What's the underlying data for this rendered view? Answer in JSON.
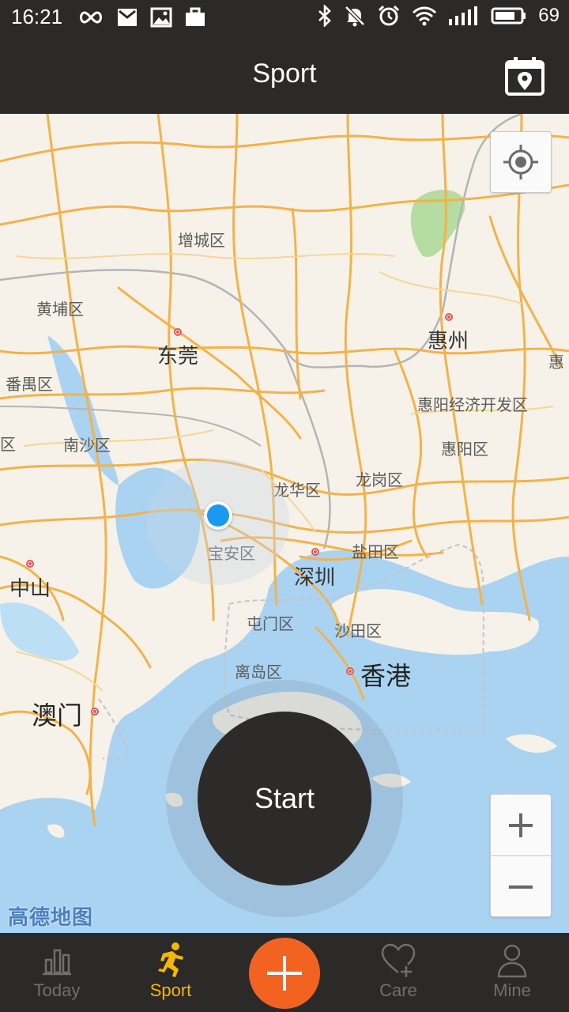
{
  "status_bar": {
    "time": "16:21",
    "battery": "69",
    "icons": [
      "infinity-icon",
      "mail-icon",
      "image-icon",
      "briefcase-icon",
      "bluetooth-icon",
      "mute-icon",
      "alarm-icon",
      "wifi-icon",
      "signal-icon",
      "battery-icon"
    ]
  },
  "header": {
    "title": "Sport",
    "calendar_icon": "calendar-location-icon"
  },
  "map": {
    "provider": "高德地图",
    "labels": [
      {
        "name": "zengcheng",
        "text": "增城区"
      },
      {
        "name": "huangpu",
        "text": "黄埔区"
      },
      {
        "name": "dongguan",
        "text": "东莞"
      },
      {
        "name": "huizhou",
        "text": "惠州"
      },
      {
        "name": "panyu",
        "text": "番禺区"
      },
      {
        "name": "huiyang-dev",
        "text": "惠阳经济开发区"
      },
      {
        "name": "nansha",
        "text": "南沙区"
      },
      {
        "name": "huiyang",
        "text": "惠阳区"
      },
      {
        "name": "longhua",
        "text": "龙华区"
      },
      {
        "name": "longgang",
        "text": "龙岗区"
      },
      {
        "name": "baoan",
        "text": "宝安区"
      },
      {
        "name": "yantian",
        "text": "盐田区"
      },
      {
        "name": "shenzhen",
        "text": "深圳"
      },
      {
        "name": "zhongshan",
        "text": "中山"
      },
      {
        "name": "tuenmun",
        "text": "屯门区"
      },
      {
        "name": "shatin",
        "text": "沙田区"
      },
      {
        "name": "islands",
        "text": "离岛区"
      },
      {
        "name": "hongkong",
        "text": "香港"
      },
      {
        "name": "macau",
        "text": "澳门"
      },
      {
        "name": "hui-edge",
        "text": "惠"
      },
      {
        "name": "qu-edge",
        "text": "区"
      }
    ],
    "zoom_in": "+",
    "zoom_out": "−",
    "start_label": "Start",
    "accent_colors": {
      "road": "#f3b24a",
      "water": "#aad3f1",
      "green": "#b5dca1",
      "location": "#1a99f0"
    }
  },
  "nav": {
    "items": [
      {
        "label": "Today",
        "icon": "bar-chart-icon",
        "active": false
      },
      {
        "label": "Sport",
        "icon": "runner-icon",
        "active": true
      },
      {
        "label": "",
        "icon": "plus-icon",
        "active": false
      },
      {
        "label": "Care",
        "icon": "heart-plus-icon",
        "active": false
      },
      {
        "label": "Mine",
        "icon": "person-icon",
        "active": false
      }
    ],
    "active_color": "#f5b700",
    "plus_color": "#f26322"
  }
}
